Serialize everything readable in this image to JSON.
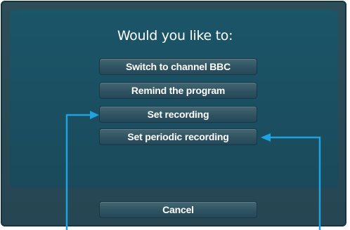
{
  "dialog": {
    "title": "Would you like to:",
    "options": [
      "Switch to channel BBC",
      "Remind the program",
      "Set recording",
      "Set periodic recording"
    ],
    "cancel_label": "Cancel"
  },
  "colors": {
    "dialog_background": "#2a4a56",
    "panel_background": "#1b5568",
    "button_background": "#2f5361",
    "text": "#ffffff",
    "pointer": "#1ea2e0"
  }
}
